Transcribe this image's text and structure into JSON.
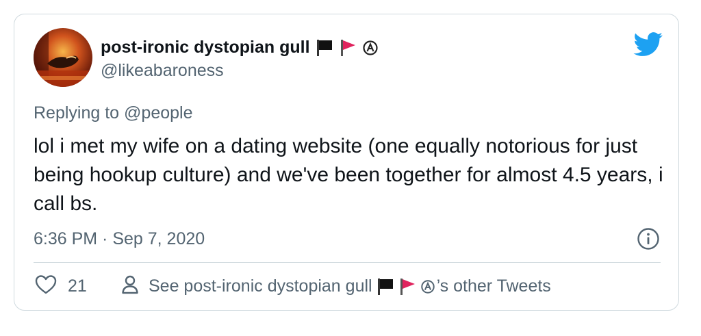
{
  "tweet": {
    "author": {
      "display_name": "post-ironic dystopian gull",
      "name_emojis": [
        "black-flag-icon",
        "red-triangular-flag-icon",
        "circled-a-icon"
      ],
      "handle": "@likeabaroness",
      "avatar": "avatar-photo-gull"
    },
    "replying_prefix": "Replying to",
    "replying_to": "@people",
    "text": "lol i met my wife on a dating website (one equally notorious for just being hookup culture) and we've been together for almost 4.5 years, i call bs.",
    "timestamp": "6:36 PM · Sep 7, 2020",
    "like_count": "21",
    "other_tweets_prefix": "See post-ironic dystopian gull",
    "other_tweets_suffix": "’s other Tweets"
  },
  "icons": {
    "brand": "twitter-bird-icon",
    "info": "info-icon",
    "like": "heart-outline-icon",
    "profile": "person-outline-icon"
  },
  "colors": {
    "twitter_blue": "#1da1f2",
    "text_primary": "#0f1419",
    "text_secondary": "#536471",
    "border": "#cfd9de",
    "red_flag": "#e0245e"
  }
}
